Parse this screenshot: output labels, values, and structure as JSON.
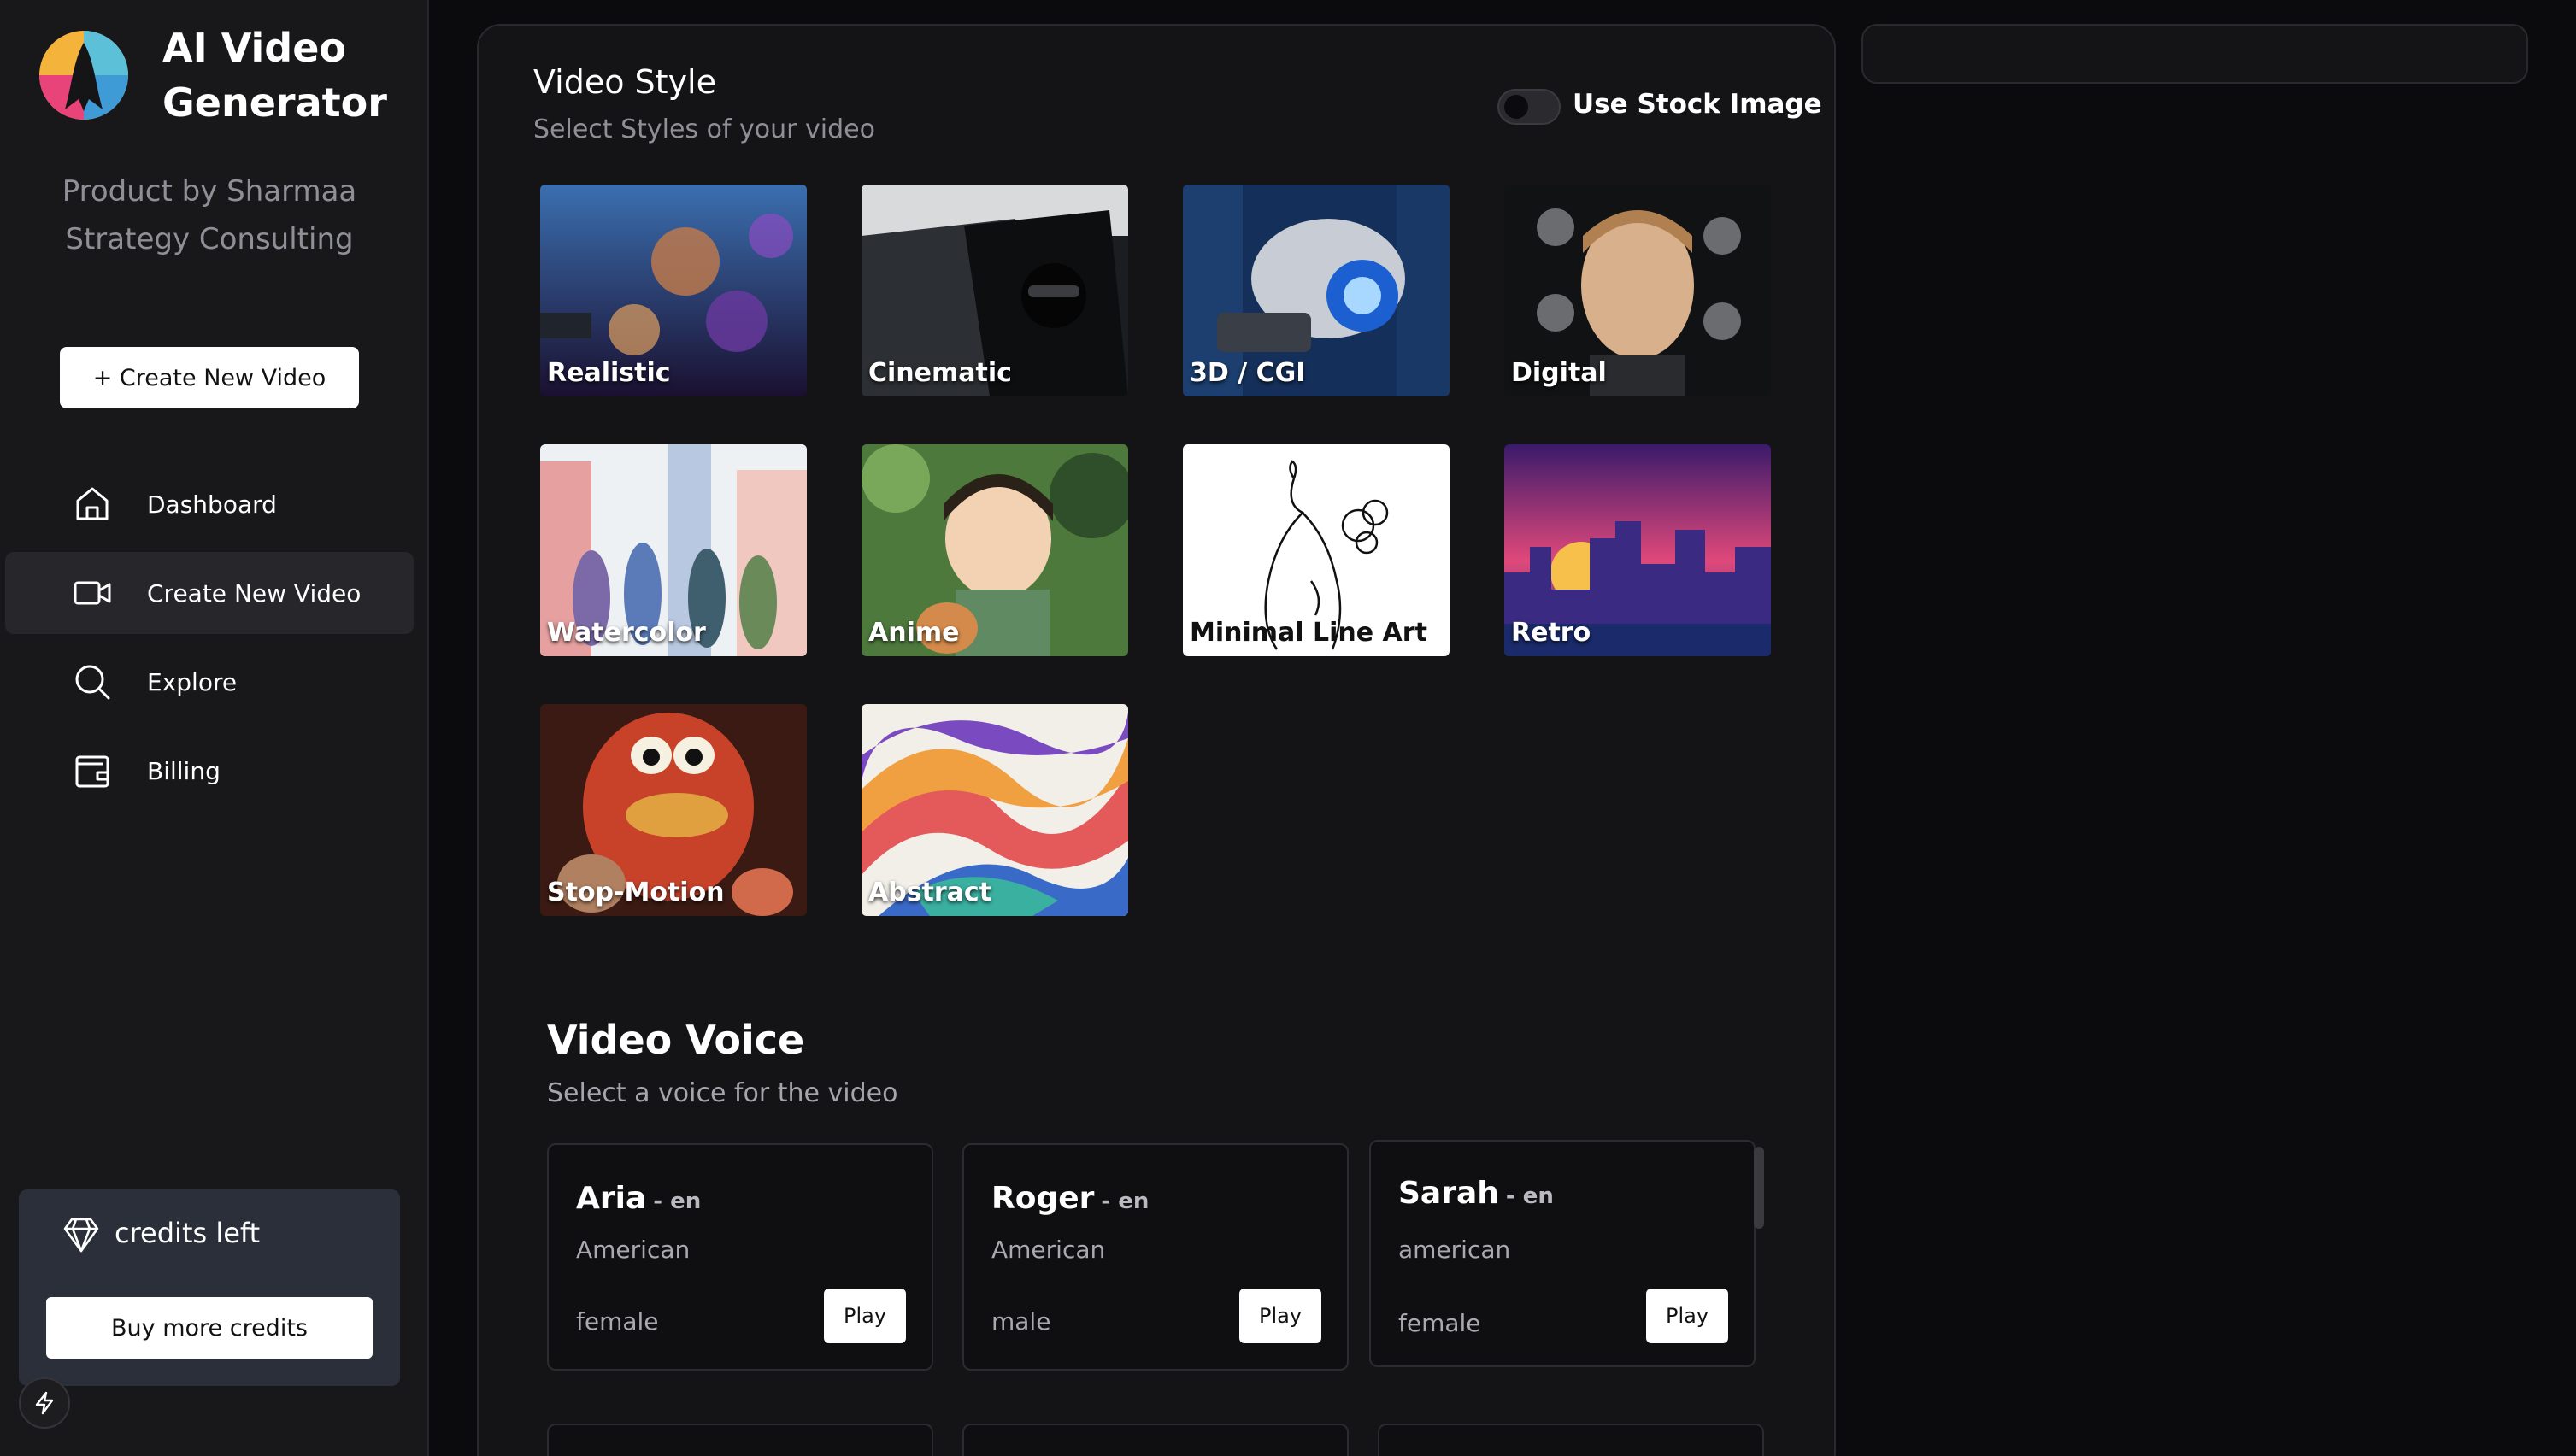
{
  "app": {
    "title_line1": "AI Video",
    "title_line2": "Generator",
    "byline_line1": "Product by Sharmaa",
    "byline_line2": "Strategy Consulting"
  },
  "sidebar": {
    "create_button": "+ Create New Video",
    "items": [
      {
        "label": "Dashboard",
        "icon": "home-icon"
      },
      {
        "label": "Create New Video",
        "icon": "video-camera-icon",
        "active": true
      },
      {
        "label": "Explore",
        "icon": "search-icon"
      },
      {
        "label": "Billing",
        "icon": "wallet-icon"
      }
    ],
    "credits_label": "credits left",
    "buy_button": "Buy more credits"
  },
  "video_style": {
    "title": "Video Style",
    "subtitle": "Select Styles of your video",
    "stock_toggle_label": "Use Stock Image",
    "stock_toggle_on": false,
    "styles": [
      {
        "label": "Realistic"
      },
      {
        "label": "Cinematic"
      },
      {
        "label": "3D / CGI"
      },
      {
        "label": "Digital"
      },
      {
        "label": "Watercolor"
      },
      {
        "label": "Anime"
      },
      {
        "label": "Minimal Line Art"
      },
      {
        "label": "Retro"
      },
      {
        "label": "Stop-Motion"
      },
      {
        "label": "Abstract"
      }
    ]
  },
  "video_voice": {
    "title": "Video Voice",
    "subtitle": "Select a voice for the video",
    "play_label": "Play",
    "voices": [
      {
        "name": "Aria",
        "lang": "- en",
        "accent": "American",
        "gender": "female"
      },
      {
        "name": "Roger",
        "lang": "- en",
        "accent": "American",
        "gender": "male"
      },
      {
        "name": "Sarah",
        "lang": "- en",
        "accent": "american",
        "gender": "female"
      }
    ]
  },
  "colors": {
    "background": "#0b0b0d",
    "sidebar": "#18181b",
    "panel": "#141417",
    "credits_box": "#2a2f3a",
    "accent_white": "#ffffff"
  }
}
